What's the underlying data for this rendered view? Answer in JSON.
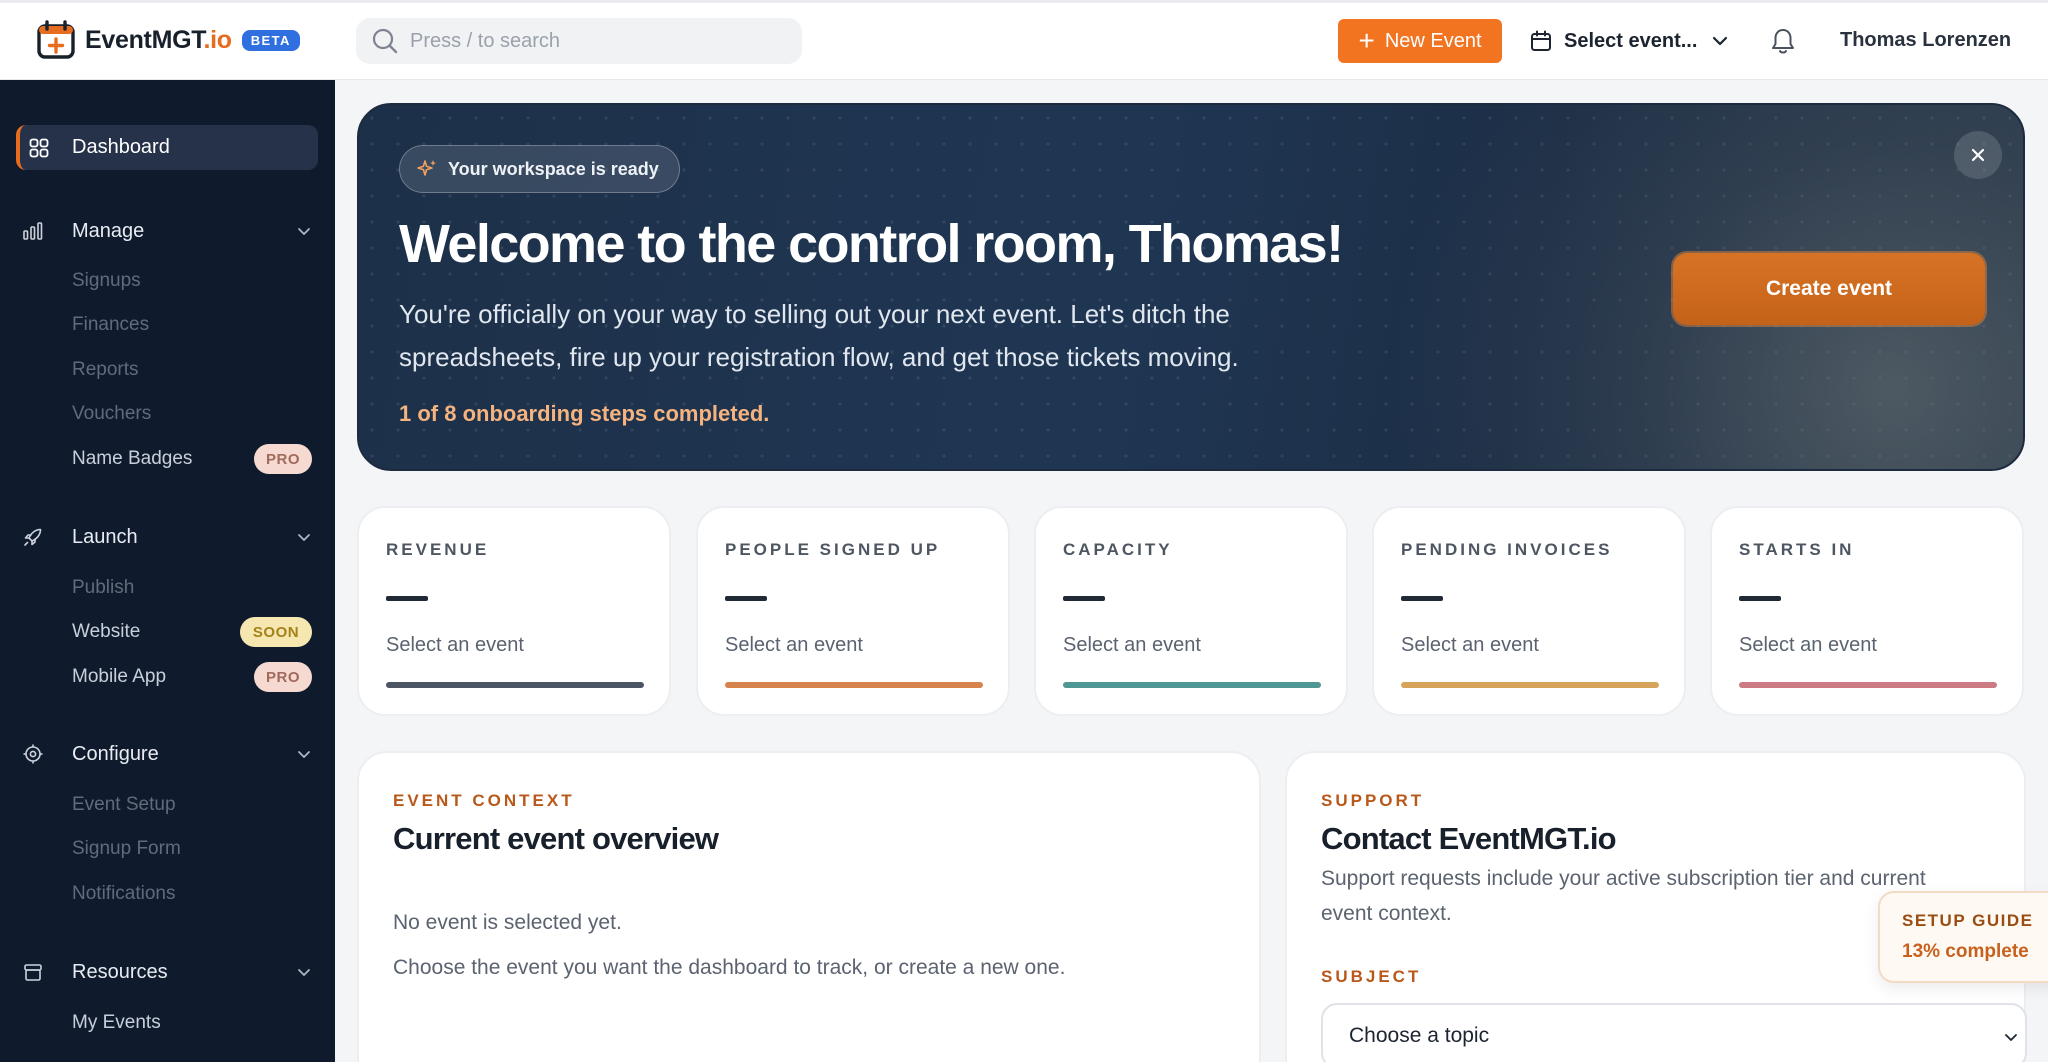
{
  "brand": {
    "name_main": "EventMGT",
    "name_suffix": ".io",
    "badge": "BETA"
  },
  "search": {
    "placeholder": "Press / to search"
  },
  "header": {
    "new_event_label": "New Event",
    "event_select_label": "Select event...",
    "user_name": "Thomas Lorenzen"
  },
  "sidebar": {
    "active": "Dashboard",
    "sections": [
      {
        "label": "Manage",
        "items": [
          {
            "label": "Signups",
            "state": "dim"
          },
          {
            "label": "Finances",
            "state": "dim"
          },
          {
            "label": "Reports",
            "state": "dim"
          },
          {
            "label": "Vouchers",
            "state": "dim"
          },
          {
            "label": "Name Badges",
            "state": "bright",
            "badge": "PRO"
          }
        ]
      },
      {
        "label": "Launch",
        "items": [
          {
            "label": "Publish",
            "state": "dim"
          },
          {
            "label": "Website",
            "state": "bright",
            "badge": "SOON"
          },
          {
            "label": "Mobile App",
            "state": "bright",
            "badge": "PRO"
          }
        ]
      },
      {
        "label": "Configure",
        "items": [
          {
            "label": "Event Setup",
            "state": "dim"
          },
          {
            "label": "Signup Form",
            "state": "dim"
          },
          {
            "label": "Notifications",
            "state": "dim"
          }
        ]
      },
      {
        "label": "Resources",
        "items": [
          {
            "label": "My Events",
            "state": "bright"
          }
        ]
      }
    ]
  },
  "hero": {
    "pill": "Your workspace is ready",
    "title": "Welcome to the control room, Thomas!",
    "description": "You're officially on your way to selling out your next event. Let's ditch the spreadsheets, fire up your registration flow, and get those tickets moving.",
    "progress_text": "1 of 8 onboarding steps completed.",
    "cta": "Create event"
  },
  "stats": [
    {
      "title": "REVENUE",
      "value": "—",
      "hint": "Select an event",
      "color": "#4c5563"
    },
    {
      "title": "PEOPLE SIGNED UP",
      "value": "—",
      "hint": "Select an event",
      "color": "#d8834e"
    },
    {
      "title": "CAPACITY",
      "value": "—",
      "hint": "Select an event",
      "color": "#4e9792"
    },
    {
      "title": "PENDING INVOICES",
      "value": "—",
      "hint": "Select an event",
      "color": "#d6a35a"
    },
    {
      "title": "STARTS IN",
      "value": "—",
      "hint": "Select an event",
      "color": "#cc7b85"
    }
  ],
  "event_context": {
    "eyebrow": "EVENT CONTEXT",
    "title": "Current event overview",
    "line1": "No event is selected yet.",
    "line2": "Choose the event you want the dashboard to track, or create a new one."
  },
  "support": {
    "eyebrow": "SUPPORT",
    "title": "Contact EventMGT.io",
    "desc_line1": "Support requests include your active subscription tier and current",
    "desc_line2": "event context.",
    "subject_label": "SUBJECT",
    "topic_value": "Choose a topic"
  },
  "setup_guide": {
    "title": "SETUP GUIDE",
    "progress": "13% complete"
  },
  "colors": {
    "accent": "#f27421",
    "sidebar_bg": "#0f1b2d",
    "beta": "#2f6fe0"
  }
}
